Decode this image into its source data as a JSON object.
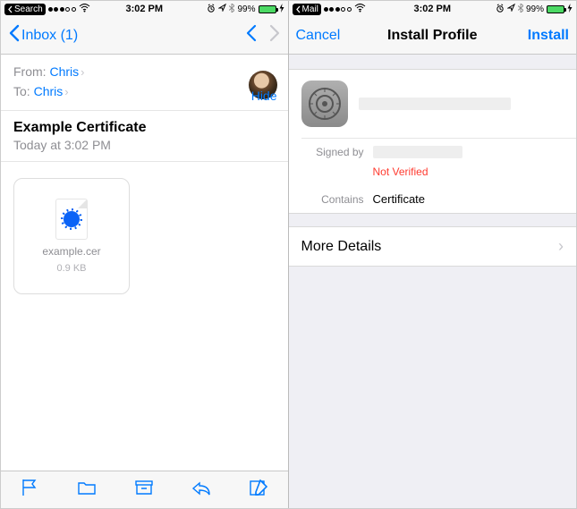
{
  "left": {
    "status": {
      "back_app": "Search",
      "time": "3:02 PM",
      "battery_pct": "99%"
    },
    "nav": {
      "back_label": "Inbox (1)"
    },
    "from_label": "From:",
    "from_name": "Chris",
    "to_label": "To:",
    "to_name": "Chris",
    "hide": "Hide",
    "subject": "Example Certificate",
    "date": "Today at 3:02 PM",
    "attachment": {
      "name": "example.cer",
      "size": "0.9 KB"
    }
  },
  "right": {
    "status": {
      "back_app": "Mail",
      "time": "3:02 PM",
      "battery_pct": "99%"
    },
    "nav": {
      "cancel": "Cancel",
      "title": "Install Profile",
      "install": "Install"
    },
    "signed_by_label": "Signed by",
    "not_verified": "Not Verified",
    "contains_label": "Contains",
    "contains_value": "Certificate",
    "more_details": "More Details"
  }
}
